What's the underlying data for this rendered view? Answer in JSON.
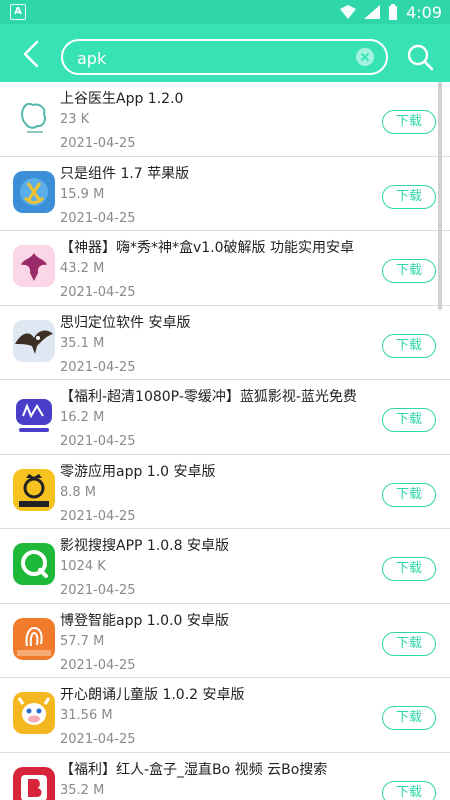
{
  "status": {
    "time": "4:09",
    "left_badge": "A"
  },
  "search": {
    "value": "apk"
  },
  "colors": {
    "accent": "#37e3b5",
    "accent_dark": "#2fd6a9"
  },
  "items": [
    {
      "title": "上谷医生App 1.2.0",
      "size": "23 K",
      "date": "2021-04-25",
      "button": "下载",
      "icon": "brain-icon"
    },
    {
      "title": "只是组件 1.7 苹果版",
      "size": "15.9 M",
      "date": "2021-04-25",
      "button": "下载",
      "icon": "anchor-app-icon"
    },
    {
      "title": "【神器】嗨*秀*神*盒v1.0破解版 功能实用安卓",
      "size": "43.2 M",
      "date": "2021-04-25",
      "button": "下载",
      "icon": "fairy-icon"
    },
    {
      "title": "思归定位软件 安卓版",
      "size": "35.1 M",
      "date": "2021-04-25",
      "button": "下载",
      "icon": "eagle-icon"
    },
    {
      "title": "【福利-超清1080P-零缓冲】蓝狐影视-蓝光免费",
      "size": "16.2 M",
      "date": "2021-04-25",
      "button": "下载",
      "icon": "fox-video-icon"
    },
    {
      "title": "零游应用app 1.0 安卓版",
      "size": "8.8 M",
      "date": "2021-04-25",
      "button": "下载",
      "icon": "crown-icon"
    },
    {
      "title": "影视搜搜APP 1.0.8 安卓版",
      "size": "1024 K",
      "date": "2021-04-25",
      "button": "下载",
      "icon": "search-bubble-icon"
    },
    {
      "title": "博登智能app 1.0.0 安卓版",
      "size": "57.7 M",
      "date": "2021-04-25",
      "button": "下载",
      "icon": "fingerprint-icon"
    },
    {
      "title": "开心朗诵儿童版 1.0.2 安卓版",
      "size": "31.56 M",
      "date": "2021-04-25",
      "button": "下载",
      "icon": "cow-icon"
    },
    {
      "title": "【福利】红人-盒子_湿直Bo 视频 云Bo搜索",
      "size": "35.2 M",
      "date": "",
      "button": "下载",
      "icon": "red-b-icon"
    }
  ]
}
